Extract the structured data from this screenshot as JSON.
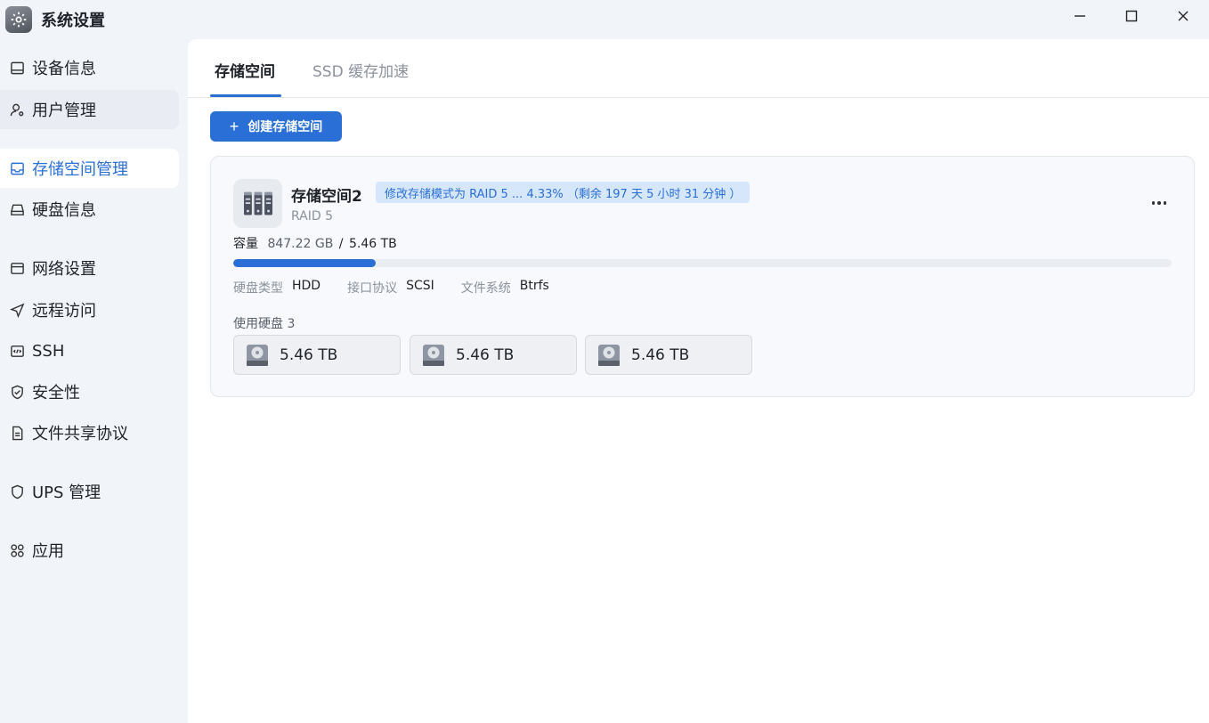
{
  "window": {
    "title": "系统设置"
  },
  "sidebar": {
    "items": [
      {
        "label": "设备信息",
        "icon": "device-icon"
      },
      {
        "label": "用户管理",
        "icon": "user-gear-icon"
      },
      {
        "label": "存储空间管理",
        "icon": "storage-icon"
      },
      {
        "label": "硬盘信息",
        "icon": "disk-icon"
      },
      {
        "label": "网络设置",
        "icon": "network-icon"
      },
      {
        "label": "远程访问",
        "icon": "remote-access-icon"
      },
      {
        "label": "SSH",
        "icon": "code-icon"
      },
      {
        "label": "安全性",
        "icon": "shield-check-icon"
      },
      {
        "label": "文件共享协议",
        "icon": "document-icon"
      },
      {
        "label": "UPS 管理",
        "icon": "shield-icon"
      },
      {
        "label": "应用",
        "icon": "apps-icon"
      }
    ],
    "active_index": 2
  },
  "tabs": [
    {
      "label": "存储空间"
    },
    {
      "label": "SSD 缓存加速"
    }
  ],
  "toolbar": {
    "create_label": "创建存储空间"
  },
  "storage": {
    "name": "存储空间2",
    "status": "修改存储模式为 RAID 5 ... 4.33%  （剩余 197 天 5 小时 31 分钟 ）",
    "raid": "RAID 5",
    "capacity_label": "容量",
    "used": "847.22 GB",
    "total": "5.46 TB",
    "used_fraction": 0.152,
    "disk_type_label": "硬盘类型",
    "disk_type": "HDD",
    "interface_label": "接口协议",
    "interface": "SCSI",
    "fs_label": "文件系统",
    "fs": "Btrfs",
    "disks_label": "使用硬盘 3",
    "disks": [
      {
        "size": "5.46 TB"
      },
      {
        "size": "5.46 TB"
      },
      {
        "size": "5.46 TB"
      }
    ]
  },
  "colors": {
    "accent": "#2a6fd6",
    "badge_bg": "#d6e6fb",
    "sidebar_bg": "#f1f4f9"
  }
}
